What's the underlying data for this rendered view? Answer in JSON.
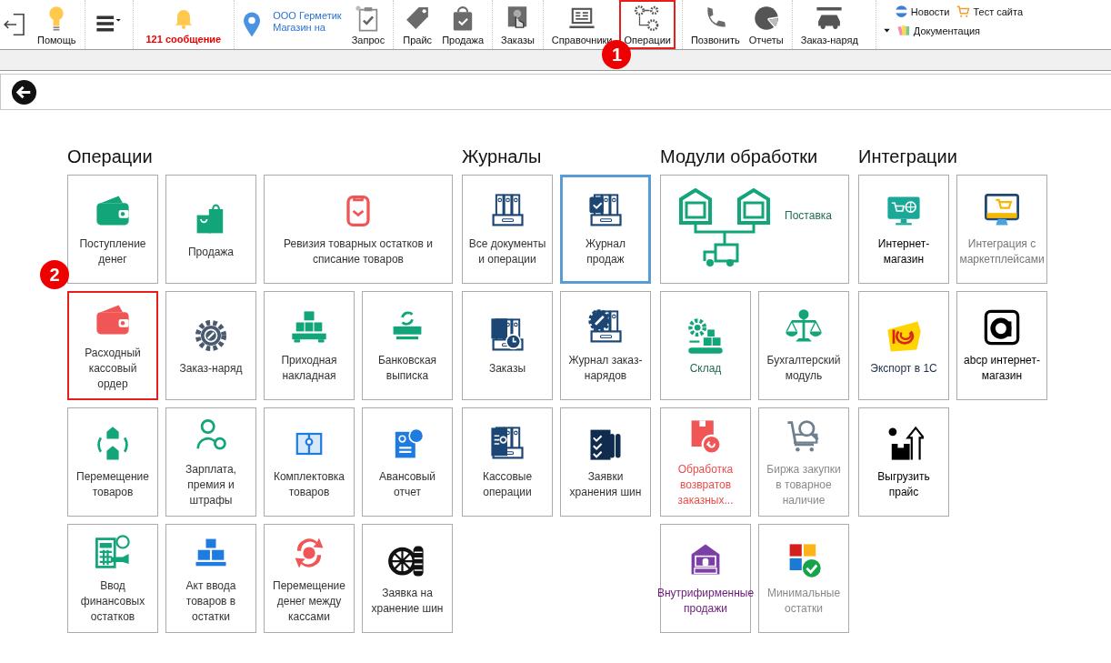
{
  "toolbar": {
    "items": [
      {
        "label": "Помощь",
        "highlighted": false
      },
      {
        "label": "121 сообщение",
        "highlighted": false
      },
      {
        "label": "Запрос",
        "highlighted": false
      },
      {
        "label": "Прайс",
        "highlighted": false
      },
      {
        "label": "Продажа",
        "highlighted": false
      },
      {
        "label": "Заказы",
        "highlighted": false
      },
      {
        "label": "Справочники",
        "highlighted": false
      },
      {
        "label": "Операции",
        "highlighted": true,
        "callout": "1"
      },
      {
        "label": "Позвонить",
        "highlighted": false
      },
      {
        "label": "Отчеты",
        "highlighted": false
      },
      {
        "label": "Заказ-наряд",
        "highlighted": false
      }
    ],
    "store": [
      "ООО Герметик",
      "Магазин на"
    ],
    "links": [
      "Новости",
      "Тест сайта",
      "Документация"
    ]
  },
  "sections": [
    {
      "title": "Операции",
      "rows": [
        {
          "tiles": [
            {
              "label": "Поступление денег",
              "kind": "standard",
              "selected": false,
              "highlighted": false
            },
            {
              "label": "Продажа",
              "kind": "standard",
              "selected": false,
              "highlighted": false
            },
            {
              "label": "Ревизия товарных остатков и списание товаров",
              "kind": "wide",
              "selected": false,
              "highlighted": false
            }
          ]
        },
        {
          "tiles": [
            {
              "label": "Расходный кассовый ордер",
              "kind": "standard",
              "selected": false,
              "highlighted": true,
              "callout": "2"
            },
            {
              "label": "Заказ-наряд",
              "kind": "standard",
              "selected": false,
              "highlighted": false
            },
            {
              "label": "Приходная накладная",
              "kind": "standard",
              "selected": false,
              "highlighted": false
            },
            {
              "label": "Банковская выписка",
              "kind": "standard",
              "selected": false,
              "highlighted": false
            }
          ]
        },
        {
          "tiles": [
            {
              "label": "Перемещение товаров",
              "kind": "standard",
              "selected": false,
              "highlighted": false
            },
            {
              "label": "Зарплата, премия и штрафы",
              "kind": "standard",
              "selected": false,
              "highlighted": false
            },
            {
              "label": "Комплектовка товаров",
              "kind": "standard",
              "selected": false,
              "highlighted": false
            },
            {
              "label": "Авансовый отчет",
              "kind": "standard",
              "selected": false,
              "highlighted": false
            }
          ]
        },
        {
          "tiles": [
            {
              "label": "Ввод финансовых остатков",
              "kind": "standard",
              "selected": false,
              "highlighted": false
            },
            {
              "label": "Акт ввода товаров в остатки",
              "kind": "standard",
              "selected": false,
              "highlighted": false
            },
            {
              "label": "Перемещение денег между кассами",
              "kind": "standard",
              "selected": false,
              "highlighted": false
            },
            {
              "label": "Заявка на хранение шин",
              "kind": "standard",
              "selected": false,
              "highlighted": false
            }
          ]
        }
      ]
    },
    {
      "title": "Журналы",
      "rows": [
        {
          "tiles": [
            {
              "label": "Все документы и операции",
              "kind": "standard",
              "selected": false,
              "highlighted": false
            },
            {
              "label": "Журнал продаж",
              "kind": "standard",
              "selected": true,
              "highlighted": false
            }
          ]
        },
        {
          "tiles": [
            {
              "label": "Заказы",
              "kind": "standard",
              "selected": false,
              "highlighted": false
            },
            {
              "label": "Журнал заказ-нарядов",
              "kind": "standard",
              "selected": false,
              "highlighted": false
            }
          ]
        },
        {
          "tiles": [
            {
              "label": "Кассовые операции",
              "kind": "standard",
              "selected": false,
              "highlighted": false
            },
            {
              "label": "Заявки хранения шин",
              "kind": "standard",
              "selected": false,
              "highlighted": false
            }
          ]
        }
      ]
    },
    {
      "title": "Модули обработки",
      "rows": [
        {
          "tiles": [
            {
              "label": "Поставка",
              "kind": "side",
              "selected": false,
              "highlighted": false,
              "color": "#1f6b55"
            }
          ]
        },
        {
          "tiles": [
            {
              "label": "Склад",
              "kind": "standard",
              "selected": false,
              "highlighted": false,
              "color": "#1f6b55"
            },
            {
              "label": "Бухгалтерский модуль",
              "kind": "standard",
              "selected": false,
              "highlighted": false
            }
          ]
        },
        {
          "tiles": [
            {
              "label": "Обработка возвратов заказных...",
              "kind": "standard",
              "selected": false,
              "highlighted": false,
              "color": "#ef4b4b"
            },
            {
              "label": "Биржа закупки в товарное наличие",
              "kind": "standard",
              "selected": false,
              "highlighted": false,
              "color": "#8a8a8a"
            }
          ]
        },
        {
          "tiles": [
            {
              "label": "Внутрифирменные продажи",
              "kind": "standard",
              "selected": false,
              "highlighted": false,
              "color": "#6a1b7a"
            },
            {
              "label": "Минимальные остатки",
              "kind": "standard",
              "selected": false,
              "highlighted": false,
              "color": "#8a8a8a"
            }
          ]
        }
      ]
    },
    {
      "title": "Интеграции",
      "rows": [
        {
          "tiles": [
            {
              "label": "Интернет-магазин",
              "kind": "standard",
              "selected": false,
              "highlighted": false,
              "color": "#000000"
            },
            {
              "label": "Интеграция с маркетплейсами",
              "kind": "standard",
              "selected": false,
              "highlighted": false,
              "color": "#777777"
            }
          ]
        },
        {
          "tiles": [
            {
              "label": "Экспорт в 1С",
              "kind": "standard",
              "selected": false,
              "highlighted": false,
              "color": "#23334f"
            },
            {
              "label": "abcp интернет-магазин",
              "kind": "standard",
              "selected": false,
              "highlighted": false,
              "color": "#000000"
            }
          ]
        },
        {
          "tiles": [
            {
              "label": "Выгрузить прайс",
              "kind": "standard",
              "selected": false,
              "highlighted": false,
              "color": "#000000"
            }
          ]
        }
      ]
    }
  ]
}
